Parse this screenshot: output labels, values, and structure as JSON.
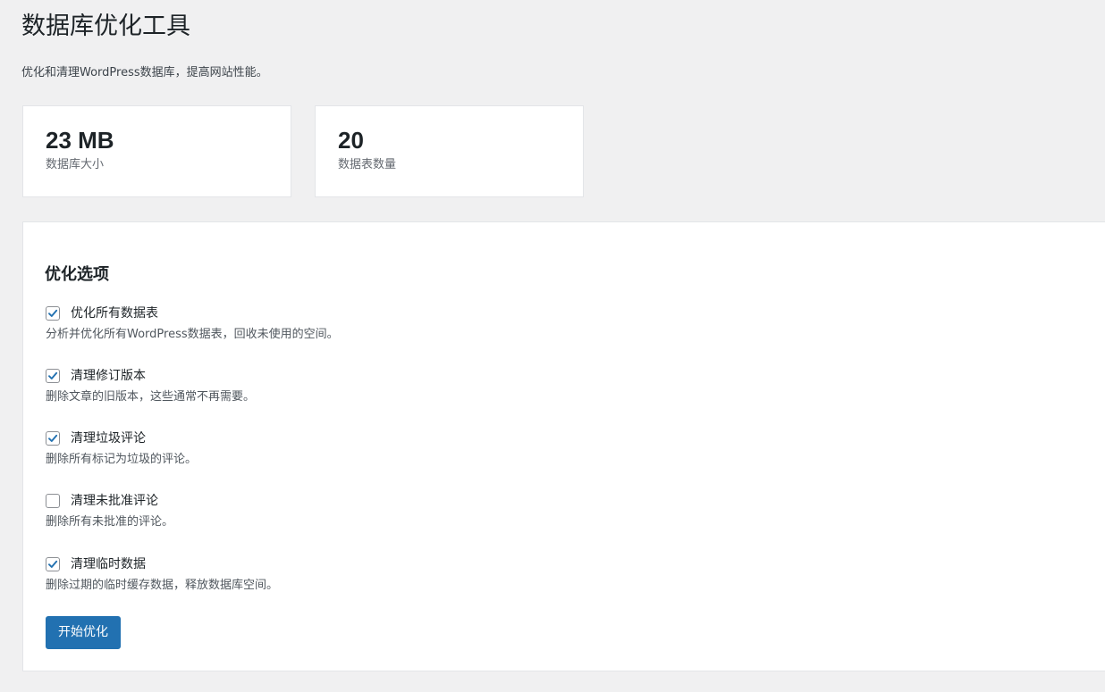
{
  "page": {
    "title": "数据库优化工具",
    "description": "优化和清理WordPress数据库，提高网站性能。"
  },
  "stats": {
    "db_size": {
      "value": "23 MB",
      "label": "数据库大小"
    },
    "table_count": {
      "value": "20",
      "label": "数据表数量"
    }
  },
  "options_panel": {
    "title": "优化选项",
    "options": [
      {
        "label": "优化所有数据表",
        "description": "分析并优化所有WordPress数据表，回收未使用的空间。",
        "checked": true
      },
      {
        "label": "清理修订版本",
        "description": "删除文章的旧版本，这些通常不再需要。",
        "checked": true
      },
      {
        "label": "清理垃圾评论",
        "description": "删除所有标记为垃圾的评论。",
        "checked": true
      },
      {
        "label": "清理未批准评论",
        "description": "删除所有未批准的评论。",
        "checked": false
      },
      {
        "label": "清理临时数据",
        "description": "删除过期的临时缓存数据，释放数据库空间。",
        "checked": true
      }
    ],
    "submit_label": "开始优化"
  },
  "colors": {
    "accent": "#2271b1",
    "background": "#f0f0f1",
    "card": "#ffffff"
  },
  "icons": {
    "checkbox_checked": "checkmark-icon"
  }
}
